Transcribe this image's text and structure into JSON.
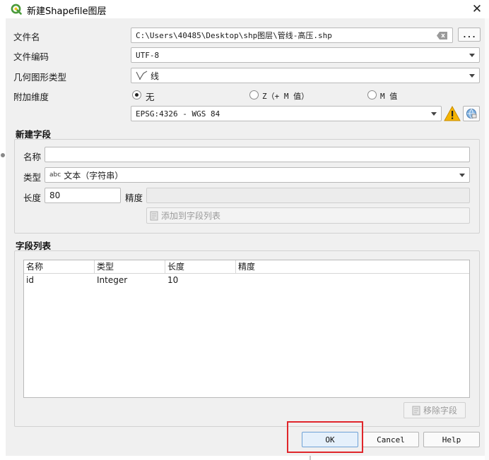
{
  "window": {
    "title": "新建Shapefile图层",
    "close_glyph": "✕"
  },
  "form": {
    "file_name_label": "文件名",
    "file_name_value": "C:\\Users\\40485\\Desktop\\shp图层\\管线-高压.shp",
    "browse_label": "...",
    "encoding_label": "文件编码",
    "encoding_value": "UTF-8",
    "geometry_label": "几何图形类型",
    "geometry_value": "线",
    "dimension_label": "附加维度",
    "dimension_options": [
      "无",
      "Z（+ M 值）",
      "M 值"
    ],
    "dimension_selected": "无",
    "crs_value": "EPSG:4326 - WGS 84"
  },
  "new_field": {
    "group_title": "新建字段",
    "name_label": "名称",
    "name_value": "",
    "type_label": "类型",
    "type_prefix": "abc",
    "type_value": "文本（字符串）",
    "length_label": "长度",
    "length_value": "80",
    "precision_label": "精度",
    "precision_value": "",
    "add_button": "添加到字段列表"
  },
  "field_list": {
    "group_title": "字段列表",
    "columns": [
      "名称",
      "类型",
      "长度",
      "精度"
    ],
    "rows": [
      [
        "id",
        "Integer",
        "10",
        ""
      ]
    ],
    "remove_button": "移除字段"
  },
  "buttons": {
    "ok": "OK",
    "cancel": "Cancel",
    "help": "Help"
  },
  "colors": {
    "highlight": "#e0262b",
    "qgis_green": "#4a9a3a",
    "warning": "#f5b400"
  },
  "icons": [
    "qgis-logo-icon",
    "clear-field-icon",
    "line-geometry-icon",
    "warning-icon",
    "crs-select-icon",
    "text-type-icon",
    "add-field-icon",
    "remove-field-icon"
  ]
}
